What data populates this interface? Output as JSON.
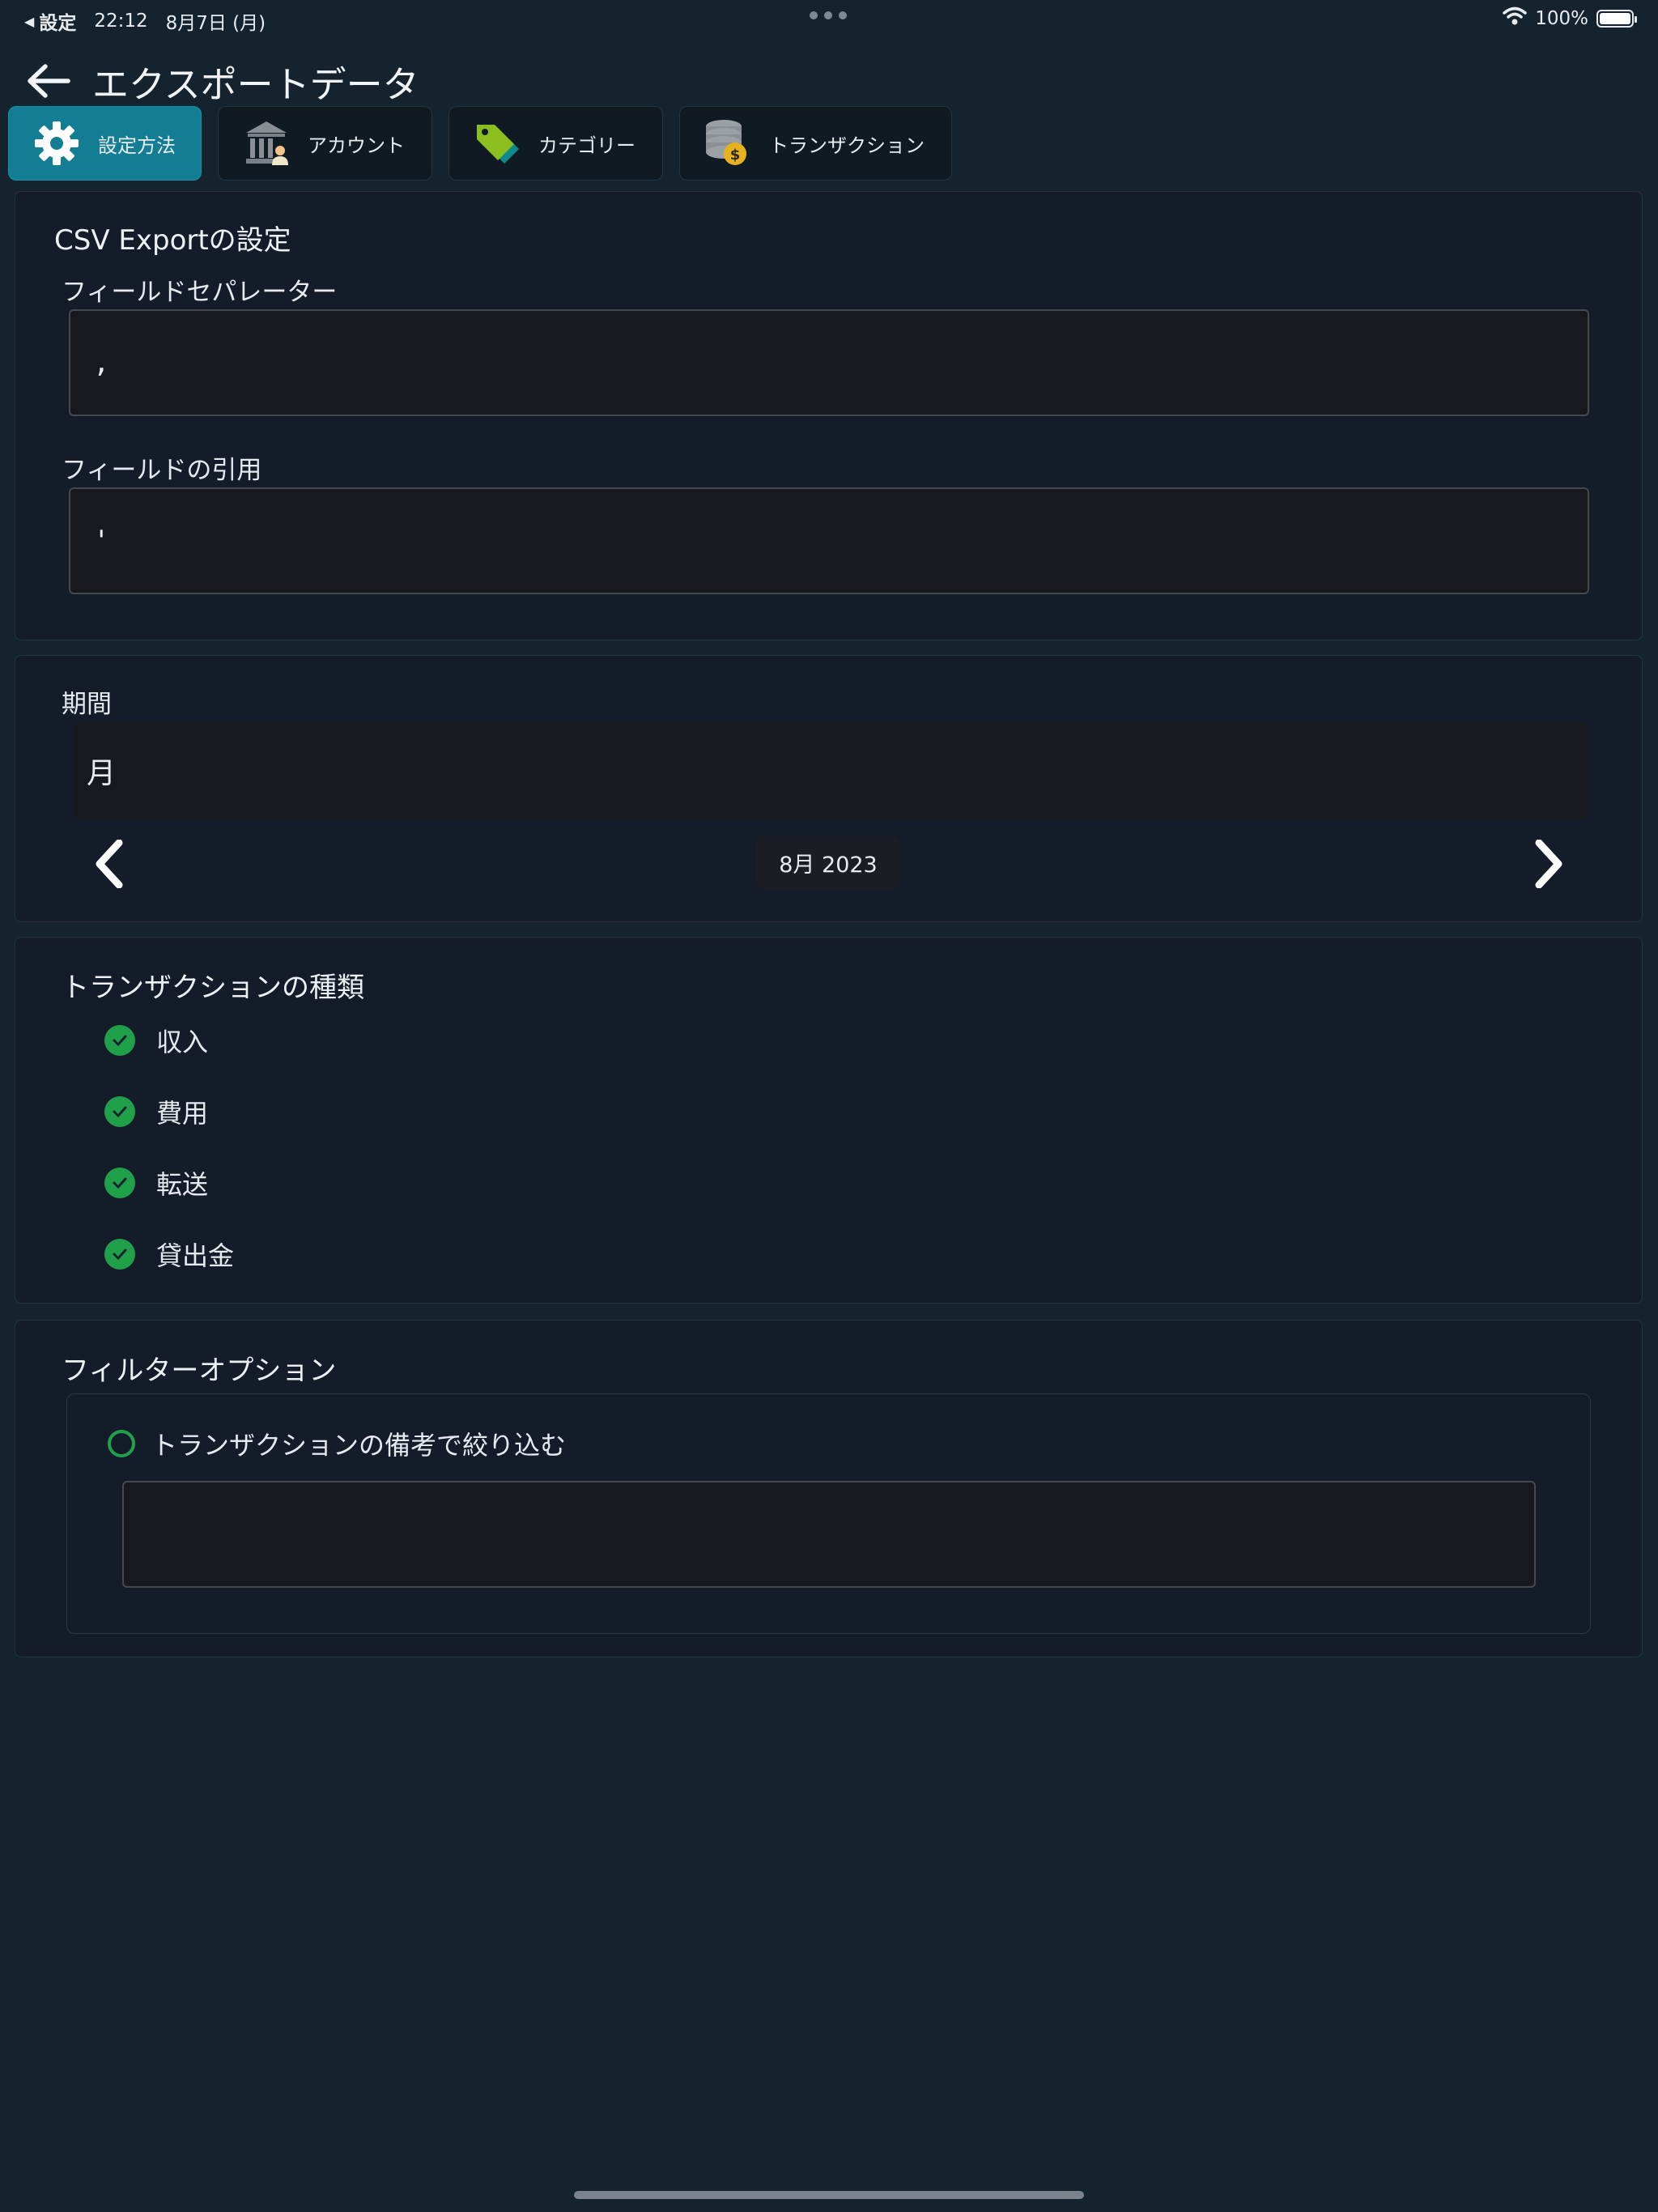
{
  "status_bar": {
    "back_app": "設定",
    "time": "22:12",
    "date": "8月7日 (月)",
    "battery": "100%"
  },
  "header": {
    "title": "エクスポートデータ"
  },
  "tabs": [
    {
      "label": "設定方法",
      "icon": "gear-icon",
      "active": true
    },
    {
      "label": "アカウント",
      "icon": "bank-icon",
      "active": false
    },
    {
      "label": "カテゴリー",
      "icon": "tag-icon",
      "active": false
    },
    {
      "label": "トランザクション",
      "icon": "coins-icon",
      "active": false
    }
  ],
  "csv": {
    "title": "CSV Exportの設定",
    "separator_label": "フィールドセパレーター",
    "separator_value": ",",
    "quote_label": "フィールドの引用",
    "quote_value": "'"
  },
  "period": {
    "label": "期間",
    "selected": "月",
    "current": "8月 2023"
  },
  "transaction_types": {
    "title": "トランザクションの種類",
    "items": [
      {
        "label": "収入",
        "checked": true
      },
      {
        "label": "費用",
        "checked": true
      },
      {
        "label": "転送",
        "checked": true
      },
      {
        "label": "貸出金",
        "checked": true
      }
    ]
  },
  "filter": {
    "title": "フィルターオプション",
    "note_filter_label": "トランザクションの備考で絞り込む",
    "note_filter_checked": false,
    "note_filter_value": ""
  },
  "colors": {
    "background": "#15232f",
    "card": "#141c2a",
    "accent_tab": "#137d93",
    "check_green": "#21a04a"
  }
}
